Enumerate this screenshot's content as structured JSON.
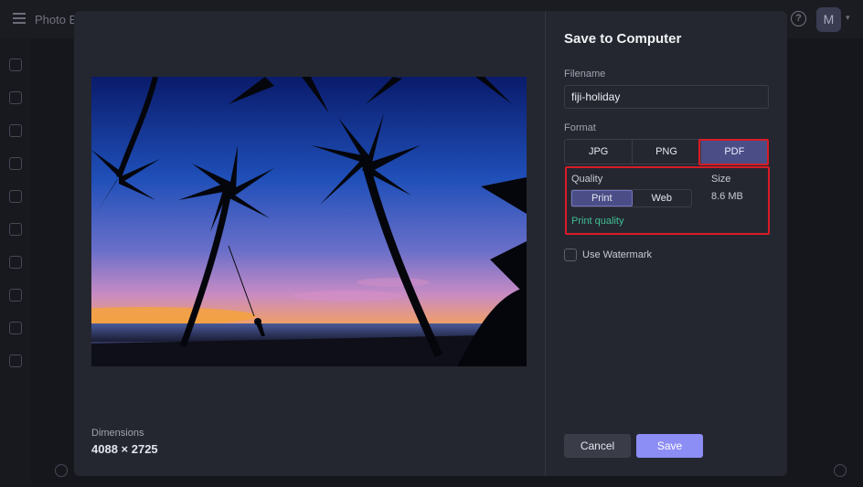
{
  "app": {
    "title": "Photo E",
    "avatar_initial": "M",
    "help_glyph": "?"
  },
  "preview": {
    "dimensions_label": "Dimensions",
    "dimensions_value": "4088 × 2725"
  },
  "dialog": {
    "title": "Save to Computer",
    "filename_label": "Filename",
    "filename_value": "fiji-holiday",
    "format_label": "Format",
    "formats": [
      {
        "label": "JPG",
        "selected": false
      },
      {
        "label": "PNG",
        "selected": false
      },
      {
        "label": "PDF",
        "selected": true
      }
    ],
    "quality_label": "Quality",
    "quality_options": [
      {
        "label": "Print",
        "selected": true
      },
      {
        "label": "Web",
        "selected": false
      }
    ],
    "quality_note": "Print quality",
    "size_label": "Size",
    "size_value": "8.6 MB",
    "watermark_label": "Use Watermark",
    "watermark_checked": false,
    "cancel_label": "Cancel",
    "save_label": "Save"
  },
  "colors": {
    "accent": "#8c8ef5",
    "selected_bg": "#4a4d86",
    "highlight": "#d81c25",
    "quality_note": "#3fbf94"
  }
}
